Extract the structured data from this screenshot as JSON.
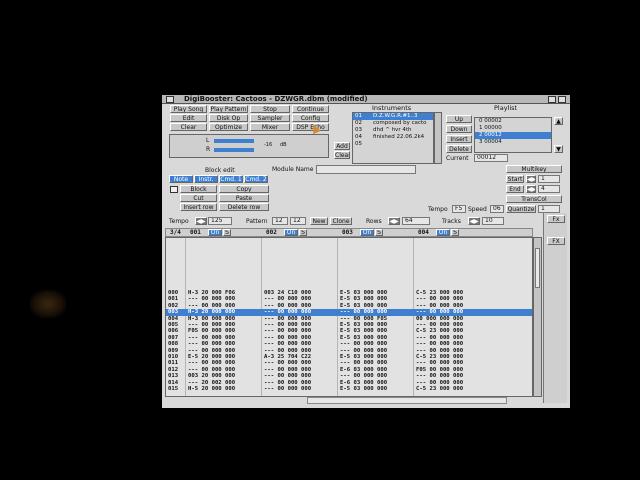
{
  "window": {
    "title": "DigiBooster: Cactoos - DZWGR.dbm (modified)"
  },
  "menu_buttons": [
    {
      "label": "Play Song"
    },
    {
      "label": "Play Pattern"
    },
    {
      "label": "Stop"
    },
    {
      "label": "Continue"
    },
    {
      "label": "Edit"
    },
    {
      "label": "Disk Op"
    },
    {
      "label": "Sampler"
    },
    {
      "label": "Config"
    },
    {
      "label": "Clear"
    },
    {
      "label": "Optimize"
    },
    {
      "label": "Mixer"
    },
    {
      "label": "DSP Echo"
    }
  ],
  "volume": {
    "l_label": "L",
    "r_label": "R",
    "readout": "-16",
    "unit": "dB"
  },
  "instruments": {
    "header": "Instruments",
    "add_label": "Add",
    "clear_label": "Clear",
    "rows": [
      {
        "num": "01",
        "name": "D.Z.W.G.R.#1..3",
        "selected": true
      },
      {
        "num": "02",
        "name": "composed by cacto",
        "selected": false
      },
      {
        "num": "03",
        "name": "dhd ^ hvr 4th",
        "selected": false
      },
      {
        "num": "04",
        "name": "finished 22.06.2k4",
        "selected": false
      },
      {
        "num": "05",
        "name": "",
        "selected": false
      }
    ]
  },
  "playlist": {
    "header": "Playlist",
    "buttons": [
      {
        "label": "Up"
      },
      {
        "label": "Down"
      },
      {
        "label": "Insert"
      },
      {
        "label": "Delete"
      }
    ],
    "current_label": "Current",
    "current_value": "00012",
    "rows": [
      {
        "text": "0  00002",
        "selected": false
      },
      {
        "text": "1  00000",
        "selected": false
      },
      {
        "text": "2  00012",
        "selected": true
      },
      {
        "text": "3  00004",
        "selected": false
      }
    ]
  },
  "block_edit": {
    "header": "Block edit",
    "tabs": [
      {
        "label": "Note"
      },
      {
        "label": "Instr."
      },
      {
        "label": "Cmd. 1"
      },
      {
        "label": "Cmd. 2"
      }
    ],
    "actions": [
      {
        "label": "Block"
      },
      {
        "label": "Copy"
      },
      {
        "label": "Cut"
      },
      {
        "label": "Paste"
      },
      {
        "label": "Insert row"
      },
      {
        "label": "Delete row"
      }
    ]
  },
  "module_name": {
    "label": "Module Name",
    "value": ""
  },
  "multikey": {
    "label": "Multikey",
    "start_label": "Start",
    "start_value": "1",
    "end_label": "End",
    "end_value": "4",
    "transcol_label": "TransCol",
    "quantize_label": "Quantize",
    "quantize_value": "1"
  },
  "tempo_speed": {
    "tempo_label": "Tempo",
    "tempo_value": "F5",
    "speed_label": "Speed",
    "speed_value": "06"
  },
  "controls": {
    "tempo_label": "Tempo",
    "tempo_value": "125",
    "pattern_label": "Pattern",
    "pattern_value": "12",
    "pattern_total": "12",
    "new_label": "New",
    "clone_label": "Clone",
    "rows_label": "Rows",
    "rows_value": "64",
    "tracks_label": "Tracks",
    "tracks_value": "10"
  },
  "tracks_header": {
    "position": "3/4",
    "tracks": [
      {
        "num": "001",
        "state": "On",
        "s": "S"
      },
      {
        "num": "002",
        "state": "On",
        "s": "S"
      },
      {
        "num": "003",
        "state": "On",
        "s": "S"
      },
      {
        "num": "004",
        "state": "On",
        "s": "S"
      }
    ]
  },
  "right_column": {
    "top_label": "Fx",
    "mid_label": "FX"
  },
  "pattern_rows": [
    {
      "n": "000",
      "c1": "H-3 20 000 F06",
      "c2": "003 24 C10 000",
      "c3": "E-5 03 000 000",
      "c4": "C-5 23 000 000"
    },
    {
      "n": "001",
      "c1": "--- 00 000 000",
      "c2": "--- 00 000 000",
      "c3": "E-5 03 000 000",
      "c4": "--- 00 000 000"
    },
    {
      "n": "002",
      "c1": "--- 00 000 000",
      "c2": "--- 00 000 000",
      "c3": "E-5 03 000 000",
      "c4": "--- 00 000 000"
    },
    {
      "n": "003",
      "c1": "H-3 20 000 000",
      "c2": "--- 00 000 000",
      "c3": "--- 00 000 000",
      "c4": "--- 00 000 000"
    },
    {
      "n": "004",
      "c1": "H-3 00 000 000",
      "c2": "--- 00 000 000",
      "c3": "--- 00 000 F05",
      "c4": "00 000 000 000"
    },
    {
      "n": "005",
      "c1": "--- 00 000 000",
      "c2": "--- 00 000 000",
      "c3": "E-5 03 000 000",
      "c4": "--- 00 000 000"
    },
    {
      "n": "006",
      "c1": "F05 00 000 000",
      "c2": "--- 00 000 000",
      "c3": "E-5 03 000 000",
      "c4": "C-5 23 000 000"
    },
    {
      "n": "007",
      "c1": "--- 00 000 000",
      "c2": "--- 00 000 000",
      "c3": "E-5 03 000 000",
      "c4": "--- 00 000 000"
    },
    {
      "n": "008",
      "c1": "--- 00 000 000",
      "c2": "--- 00 000 000",
      "c3": "--- 00 000 000",
      "c4": "--- 00 000 000"
    },
    {
      "n": "009",
      "c1": "--- 00 000 000",
      "c2": "--- 00 000 000",
      "c3": "--- 00 000 000",
      "c4": "--- 00 000 000"
    },
    {
      "n": "010",
      "c1": "E-5 20 000 000",
      "c2": "A-3 25 704 C22",
      "c3": "E-5 03 000 000",
      "c4": "C-5 23 000 000"
    },
    {
      "n": "011",
      "c1": "--- 00 000 000",
      "c2": "--- 00 000 000",
      "c3": "--- 00 000 000",
      "c4": "--- 00 000 000"
    },
    {
      "n": "012",
      "c1": "--- 00 000 000",
      "c2": "--- 00 000 000",
      "c3": "E-6 03 000 000",
      "c4": "F05 00 000 000"
    },
    {
      "n": "013",
      "c1": "003 20 000 000",
      "c2": "--- 00 000 000",
      "c3": "--- 00 000 000",
      "c4": "--- 00 000 000"
    },
    {
      "n": "014",
      "c1": "--- 20 002 000",
      "c2": "--- 00 000 000",
      "c3": "E-6 03 000 000",
      "c4": "--- 00 000 000"
    },
    {
      "n": "015",
      "c1": "H-5 20 000 000",
      "c2": "--- 00 000 000",
      "c3": "E-5 03 000 000",
      "c4": "C-5 23 000 000"
    }
  ],
  "current_row_index": 3
}
